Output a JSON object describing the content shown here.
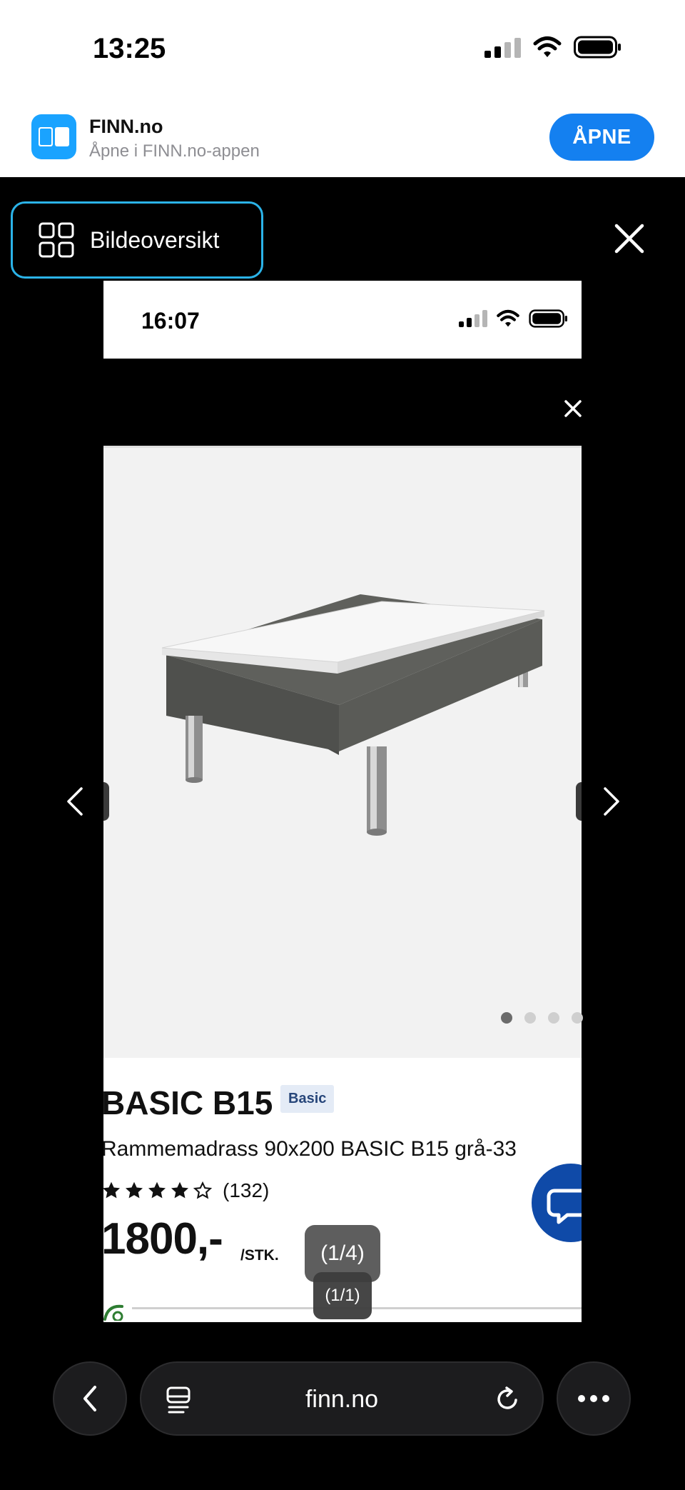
{
  "status_bar": {
    "time": "13:25"
  },
  "app_banner": {
    "app_name": "FINN.no",
    "subtitle": "Åpne i FINN.no-appen",
    "open_label": "ÅPNE"
  },
  "viewer": {
    "overview_label": "Bildeoversikt",
    "counter": "(1/4)",
    "close_icon": "close-icon",
    "prev_icon": "chevron-left-icon",
    "next_icon": "chevron-right-icon"
  },
  "inner_screenshot": {
    "status_time": "16:07",
    "image_dots": {
      "count": 4,
      "active_index": 0
    },
    "product": {
      "title": "BASIC B15",
      "badge": "Basic",
      "description": "Rammemadrass 90x200 BASIC B15 grå-33",
      "rating": 4,
      "rating_max": 5,
      "rating_count": "(132)",
      "price": "1800,-",
      "unit": "/STK."
    },
    "counter": "(1/1)"
  },
  "browser": {
    "url": "finn.no"
  },
  "colors": {
    "accent": "#1480f0",
    "focus_ring": "#2bb3e8",
    "badge_bg": "#e4ebf6",
    "chat_fab": "#0f4aa8"
  }
}
